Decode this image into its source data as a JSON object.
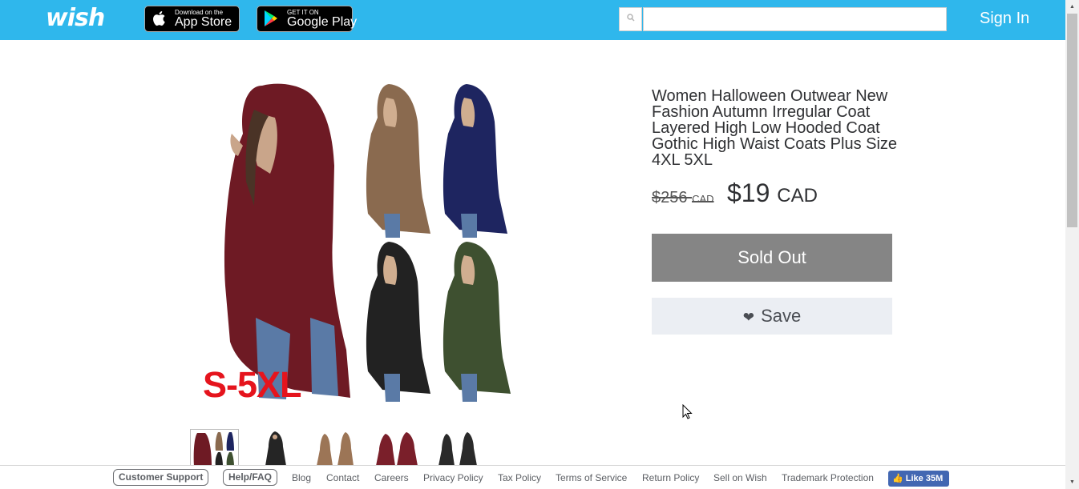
{
  "header": {
    "logo": "wish",
    "app_store": {
      "small": "Download on the",
      "big": "App Store"
    },
    "google_play": {
      "small": "GET IT ON",
      "big": "Google Play"
    },
    "search": {
      "placeholder": "",
      "value": ""
    },
    "sign_in": "Sign In",
    "background_color": "#2fb7ec"
  },
  "product": {
    "title": "Women Halloween Outwear New Fashion Autumn Irregular Coat Layered High Low Hooded Coat Gothic High Waist Coats Plus Size 4XL 5XL",
    "image_label": "S-5XL",
    "old_price": "$256",
    "old_price_currency": "CAD",
    "price": "$19",
    "price_currency": "CAD",
    "sold_out_label": "Sold Out",
    "save_label": "Save",
    "thumbnails": [
      {
        "name": "thumb-all-colors",
        "selected": true
      },
      {
        "name": "thumb-black-front",
        "selected": false
      },
      {
        "name": "thumb-brown-pair",
        "selected": false
      },
      {
        "name": "thumb-burgundy-pair",
        "selected": false
      },
      {
        "name": "thumb-black-pair",
        "selected": false
      }
    ],
    "colors": {
      "burgundy": "#6e1a24",
      "brown": "#8a6a4f",
      "navy": "#1e2560",
      "black": "#222222",
      "olive": "#3e5030"
    }
  },
  "footer": {
    "customer_support": "Customer Support",
    "help_faq": "Help/FAQ",
    "links": [
      "Blog",
      "Contact",
      "Careers",
      "Privacy Policy",
      "Tax Policy",
      "Terms of Service",
      "Return Policy",
      "Sell on Wish",
      "Trademark Protection"
    ],
    "fb_like": "Like 35M"
  }
}
